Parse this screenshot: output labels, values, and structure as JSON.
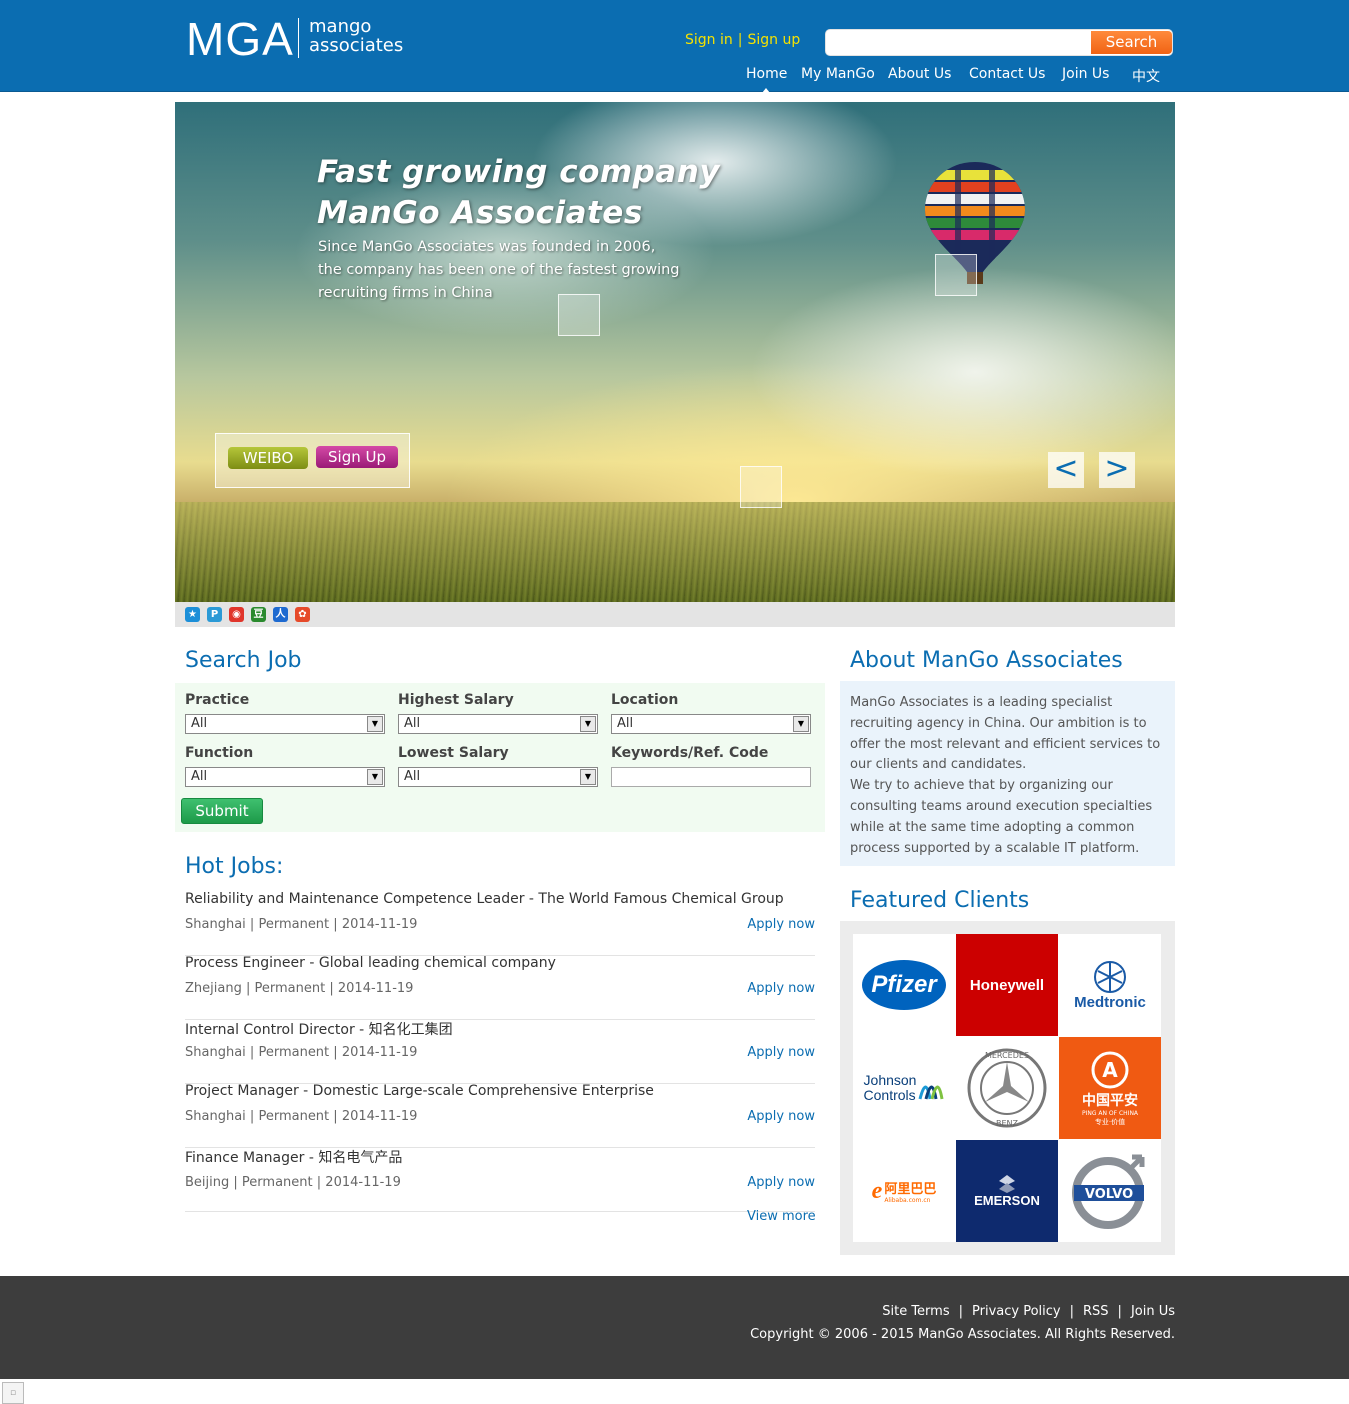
{
  "header": {
    "logo_main": "MGA",
    "logo_line1": "mango",
    "logo_line2": "associates",
    "sign_in": "Sign in",
    "separator": "|",
    "sign_up": "Sign up",
    "search_placeholder": "",
    "search_button": "Search",
    "nav": [
      "Home",
      "My ManGo",
      "About Us",
      "Contact Us",
      "Join Us",
      "中文"
    ]
  },
  "banner": {
    "title_line1": "Fast growing company",
    "title_line2": "ManGo Associates",
    "desc_line1": "Since ManGo Associates was founded in 2006,",
    "desc_line2": "the company has been one of the fastest growing",
    "desc_line3": "recruiting firms in China",
    "weibo_button": "WEIBO",
    "signup_button": "Sign Up",
    "prev": "<",
    "next": ">"
  },
  "share_icons": [
    "qzone-icon",
    "pengyou-icon",
    "weibo-icon",
    "douban-icon",
    "renren-icon",
    "kaixin-icon"
  ],
  "search_job": {
    "title": "Search Job",
    "practice_label": "Practice",
    "practice_value": "All",
    "highest_salary_label": "Highest Salary",
    "highest_salary_value": "All",
    "location_label": "Location",
    "location_value": "All",
    "function_label": "Function",
    "function_value": "All",
    "lowest_salary_label": "Lowest Salary",
    "lowest_salary_value": "All",
    "keywords_label": "Keywords/Ref. Code",
    "keywords_value": "",
    "submit": "Submit"
  },
  "hot_jobs": {
    "title": "Hot Jobs:",
    "apply_label": "Apply now",
    "meta_sep": "|",
    "jobs": [
      {
        "title": "Reliability and Maintenance Competence Leader - The World Famous Chemical Group",
        "location": "Shanghai",
        "type": "Permanent",
        "date": "2014-11-19"
      },
      {
        "title": "Process Engineer - Global leading chemical company",
        "location": "Zhejiang",
        "type": "Permanent",
        "date": "2014-11-19"
      },
      {
        "title": "Internal Control Director - 知名化工集团",
        "location": "Shanghai",
        "type": "Permanent",
        "date": "2014-11-19"
      },
      {
        "title": "Project Manager - Domestic Large-scale Comprehensive Enterprise",
        "location": "Shanghai",
        "type": "Permanent",
        "date": "2014-11-19"
      },
      {
        "title": "Finance Manager - 知名电气产品",
        "location": "Beijing",
        "type": "Permanent",
        "date": "2014-11-19"
      }
    ],
    "view_more": "View more"
  },
  "about": {
    "title": "About ManGo Associates",
    "text": "ManGo Associates is a leading specialist recruiting agency in China. Our ambition is to offer the most relevant and efficient services to our clients and candidates.",
    "text2": "We try to achieve that by organizing our consulting teams around execution specialties while at the same time adopting a common process supported by a scalable IT platform."
  },
  "featured_clients": {
    "title": "Featured Clients",
    "clients": [
      "Pfizer",
      "Honeywell",
      "Medtronic",
      "Johnson",
      "Controls",
      "MERCEDES",
      "BENZ",
      "中国平安",
      "PING AN OF CHINA",
      "专业·价值",
      "阿里巴巴",
      "Alibaba.com.cn",
      "EMERSON",
      "VOLVO"
    ]
  },
  "footer": {
    "links": [
      "Site Terms",
      "Privacy Policy",
      "RSS",
      "Join Us"
    ],
    "sep": "|",
    "copyright": "Copyright © 2006 - 2015 ManGo Associates. All Rights Reserved."
  },
  "colors": {
    "brand_blue": "#0b6db1",
    "search_orange": "#f06314",
    "auth_yellow": "#f6e200",
    "submit_green": "#1d9a49",
    "footer_gray": "#3d3d3d"
  }
}
